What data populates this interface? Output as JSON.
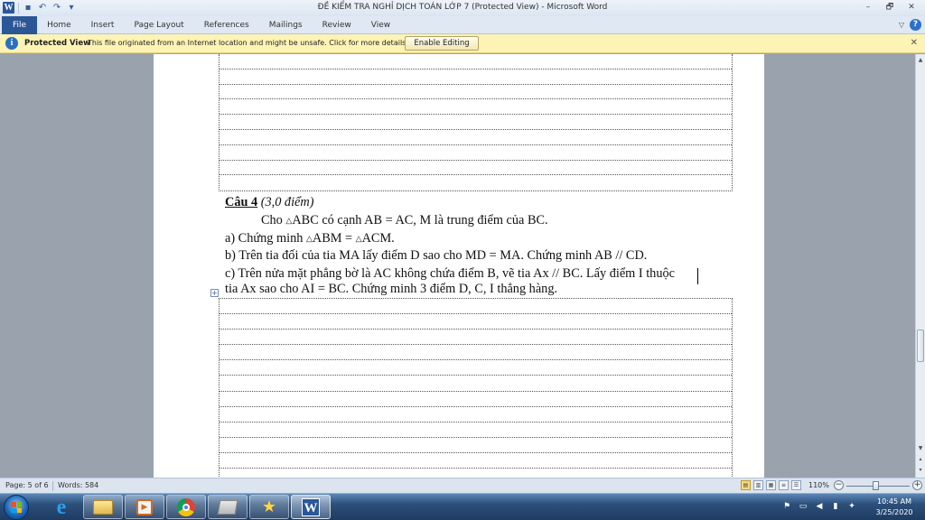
{
  "window": {
    "title": "ĐỀ KIỂM TRA NGHỈ DỊCH TOÁN  LỚP 7 (Protected View)  -  Microsoft Word",
    "app_logo": "W",
    "controls": [
      "–",
      "🗗",
      "✕"
    ]
  },
  "quick_access": {
    "icons": [
      "save-icon",
      "undo-icon",
      "redo-icon",
      "customize-icon"
    ]
  },
  "ribbon": {
    "tabs": [
      "File",
      "Home",
      "Insert",
      "Page Layout",
      "References",
      "Mailings",
      "Review",
      "View"
    ],
    "help": "?"
  },
  "protected_view": {
    "title": "Protected View",
    "message": "This file originated from an Internet location and might be unsafe. Click for more details.",
    "button": "Enable Editing"
  },
  "document": {
    "question_number": "Câu 4",
    "question_points": " (3,0 điểm)",
    "line1": "Cho  ABC có cạnh AB = AC, M là trung điểm của BC.",
    "line2": "a) Chứng minh  ABM =  ACM.",
    "line3": "b) Trên tia đối của tia MA lấy điểm D sao cho MD = MA. Chứng minh AB // CD.",
    "line4": "c) Trên nửa mặt phẳng bờ là AC không chứa điểm B, vẽ tia Ax // BC. Lấy điểm I thuộc",
    "line5": "tia  Ax sao cho AI = BC. Chứng minh 3 điểm D, C, I thẳng hàng."
  },
  "status_bar": {
    "page": "Page: 5 of 6",
    "words": "Words: 584",
    "zoom": "110%"
  },
  "taskbar": {
    "apps": [
      "internet-explorer",
      "file-explorer",
      "media-player",
      "chrome",
      "app",
      "sticky-star",
      "microsoft-word"
    ],
    "clock_time": "10:45 AM",
    "clock_date": "3/25/2020"
  }
}
